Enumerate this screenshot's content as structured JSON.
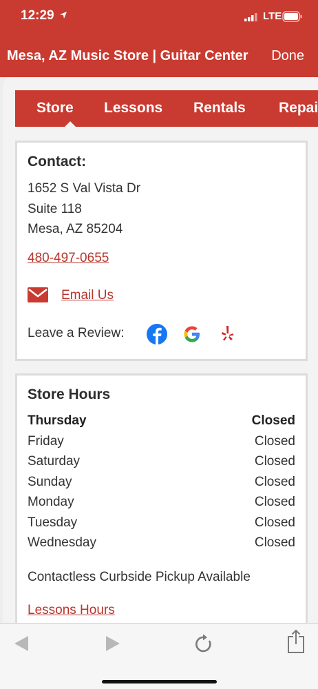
{
  "status": {
    "time": "12:29",
    "network": "LTE"
  },
  "nav": {
    "title": "Mesa, AZ Music Store | Guitar Center",
    "done": "Done"
  },
  "tabs": [
    {
      "label": "Store"
    },
    {
      "label": "Lessons"
    },
    {
      "label": "Rentals"
    },
    {
      "label": "Repairs"
    }
  ],
  "contact": {
    "heading": "Contact:",
    "address": [
      "1652 S Val Vista Dr",
      "Suite 118",
      "Mesa, AZ 85204"
    ],
    "phone": "480-497-0655",
    "email_label": "Email Us",
    "review_label": "Leave a Review:"
  },
  "hours": {
    "heading": "Store Hours",
    "days": [
      {
        "day": "Thursday",
        "status": "Closed"
      },
      {
        "day": "Friday",
        "status": "Closed"
      },
      {
        "day": "Saturday",
        "status": "Closed"
      },
      {
        "day": "Sunday",
        "status": "Closed"
      },
      {
        "day": "Monday",
        "status": "Closed"
      },
      {
        "day": "Tuesday",
        "status": "Closed"
      },
      {
        "day": "Wednesday",
        "status": "Closed"
      }
    ],
    "note": "Contactless Curbside Pickup Available",
    "lessons_link": "Lessons Hours"
  },
  "colors": {
    "brand": "#c93a30",
    "link": "#b9352c"
  },
  "icons": {
    "mail": "envelope-icon",
    "review_sites": [
      "facebook-icon",
      "google-icon",
      "yelp-icon"
    ],
    "toolbar": [
      "back-arrow-icon",
      "forward-arrow-icon",
      "reload-icon",
      "share-icon"
    ]
  }
}
